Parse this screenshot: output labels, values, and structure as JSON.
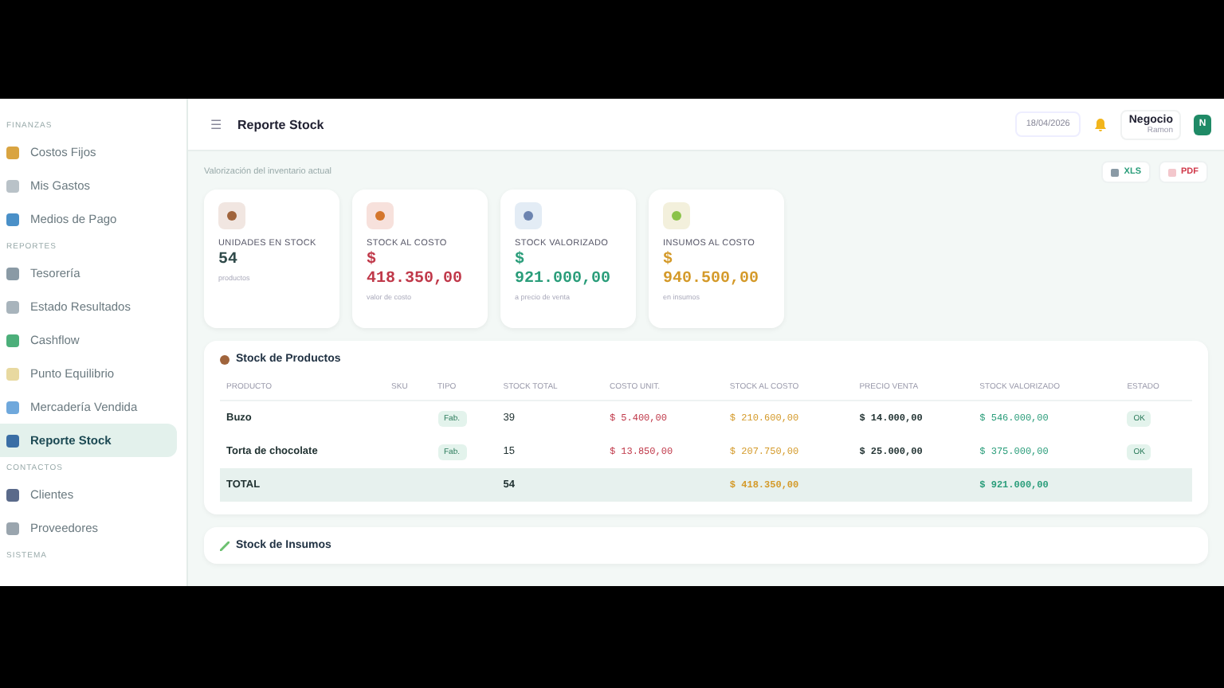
{
  "sidebar": {
    "sections": [
      {
        "title": "FINANZAS",
        "items": [
          {
            "label": "Costos Fijos",
            "selected": false
          },
          {
            "label": "Mis Gastos",
            "selected": false
          },
          {
            "label": "Medios de Pago",
            "selected": false
          }
        ]
      },
      {
        "title": "REPORTES",
        "items": [
          {
            "label": "Tesorería",
            "selected": false
          },
          {
            "label": "Estado Resultados",
            "selected": false
          },
          {
            "label": "Cashflow",
            "selected": false
          },
          {
            "label": "Punto Equilibrio",
            "selected": false
          },
          {
            "label": "Mercadería Vendida",
            "selected": false
          },
          {
            "label": "Reporte Stock",
            "selected": true
          }
        ]
      },
      {
        "title": "CONTACTOS",
        "items": [
          {
            "label": "Clientes",
            "selected": false
          },
          {
            "label": "Proveedores",
            "selected": false
          }
        ]
      },
      {
        "title": "SISTEMA"
      }
    ]
  },
  "header": {
    "menu_glyph": "☰",
    "title": "Reporte Stock",
    "date": "18/04/2026",
    "user": "Negocio",
    "user_sub": "Ramon",
    "avatar": "N"
  },
  "subtitle": "Valorización del inventario actual",
  "exports": [
    {
      "label": "XLS",
      "kind": "xls"
    },
    {
      "label": "PDF",
      "kind": "pdf"
    }
  ],
  "cards": [
    {
      "label": "UNIDADES EN STOCK",
      "value": "54",
      "note": "productos",
      "color": "#2f4a4a"
    },
    {
      "label": "STOCK AL COSTO",
      "currency": "$",
      "value": "418.350,00",
      "note": "valor de costo",
      "color": "#c0394a"
    },
    {
      "label": "STOCK VALORIZADO",
      "currency": "$",
      "value": "921.000,00",
      "note": "a precio de venta",
      "color": "#2a9d7a"
    },
    {
      "label": "INSUMOS AL COSTO",
      "currency": "$",
      "value": "940.500,00",
      "note": "en insumos",
      "color": "#d49a2a"
    }
  ],
  "products": {
    "title": "Stock de Productos",
    "columns": [
      "PRODUCTO",
      "SKU",
      "TIPO",
      "STOCK TOTAL",
      "COSTO UNIT.",
      "STOCK AL COSTO",
      "PRECIO VENTA",
      "STOCK VALORIZADO",
      "ESTADO"
    ],
    "rows": [
      {
        "producto": "Buzo",
        "tipo": "Fab.",
        "stock": "39",
        "costo": "$ 5.400,00",
        "stock_costo": "$ 210.600,00",
        "precio": "$ 14.000,00",
        "valorizado": "$ 546.000,00",
        "estado": "OK"
      },
      {
        "producto": "Torta de chocolate",
        "tipo": "Fab.",
        "stock": "15",
        "costo": "$ 13.850,00",
        "stock_costo": "$ 207.750,00",
        "precio": "$ 25.000,00",
        "valorizado": "$ 375.000,00",
        "estado": "OK"
      }
    ],
    "total": {
      "label": "TOTAL",
      "stock": "54",
      "stock_costo": "$ 418.350,00",
      "valorizado": "$ 921.000,00"
    }
  },
  "supplies": {
    "title": "Stock de Insumos"
  }
}
